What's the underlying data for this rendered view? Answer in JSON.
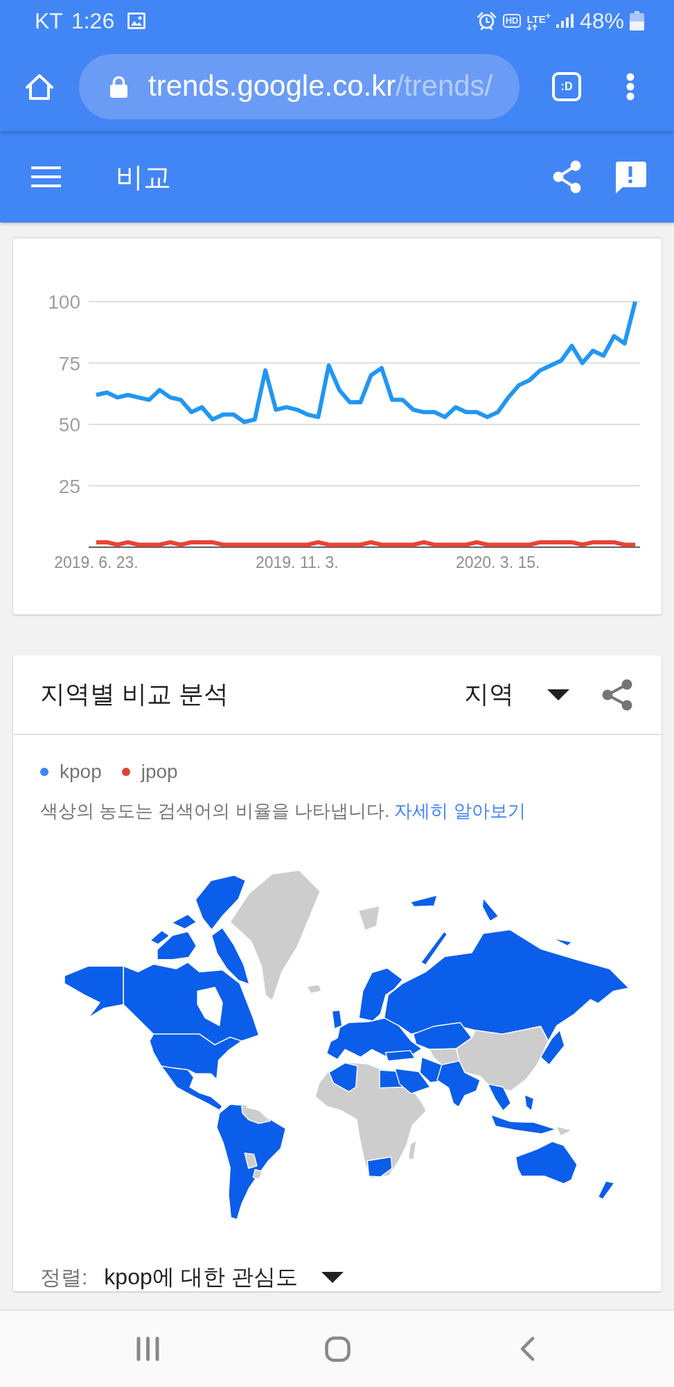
{
  "status_bar": {
    "carrier": "KT",
    "time": "1:26",
    "hd_label": "HD",
    "network": "LTE$^{+}$",
    "battery_text": "48%"
  },
  "browser": {
    "url_host": "trends.google.co.kr",
    "url_path": "/trends/",
    "tab_label": ":D"
  },
  "app_bar": {
    "title": "비교"
  },
  "trend_chart": {
    "chart_data": {
      "type": "line",
      "grid": true,
      "categories": [
        "2019. 6. 23.",
        null,
        null,
        null,
        null,
        null,
        null,
        null,
        null,
        null,
        null,
        null,
        null,
        null,
        null,
        null,
        null,
        null,
        null,
        "2019. 11. 3.",
        null,
        null,
        null,
        null,
        null,
        null,
        null,
        null,
        null,
        null,
        null,
        null,
        null,
        null,
        null,
        null,
        null,
        null,
        "2020. 3. 15.",
        null,
        null,
        null,
        null,
        null,
        null,
        null,
        null,
        null,
        null,
        null,
        null,
        null
      ],
      "ylim": [
        0,
        100
      ],
      "yticks": [
        25,
        50,
        75,
        100
      ],
      "series": [
        {
          "color": "#2196f3",
          "values": [
            62,
            63,
            61,
            62,
            61,
            60,
            64,
            61,
            60,
            55,
            57,
            52,
            54,
            54,
            51,
            52,
            72,
            56,
            57,
            56,
            54,
            53,
            74,
            64,
            59,
            59,
            70,
            73,
            60,
            60,
            56,
            55,
            55,
            53,
            57,
            55,
            55,
            53,
            55,
            61,
            66,
            68,
            72,
            74,
            76,
            82,
            75,
            80,
            78,
            86,
            83,
            100
          ]
        },
        {
          "color": "#ea4335",
          "values": [
            2,
            2,
            1,
            2,
            1,
            1,
            1,
            2,
            1,
            2,
            2,
            2,
            1,
            1,
            1,
            1,
            1,
            1,
            1,
            1,
            1,
            2,
            1,
            1,
            1,
            1,
            2,
            1,
            1,
            1,
            1,
            2,
            1,
            1,
            1,
            1,
            2,
            1,
            1,
            1,
            1,
            1,
            2,
            2,
            2,
            2,
            1,
            2,
            2,
            2,
            1,
            1
          ]
        }
      ]
    }
  },
  "region_card": {
    "title": "지역별 비교 분석",
    "scope": "지역",
    "legend": [
      {
        "label": "kpop",
        "color": "#4285f4"
      },
      {
        "label": "jpop",
        "color": "#db4437"
      }
    ],
    "description": "색상의 농도는 검색어의 비율을 나타냅니다.",
    "learn_more": "자세히 알아보기",
    "sort_label": "정렬:",
    "sort_value": "kpop에 대한 관심도"
  }
}
